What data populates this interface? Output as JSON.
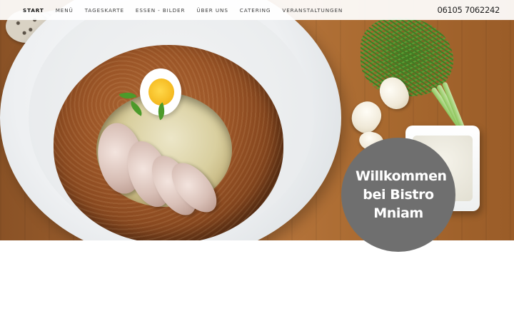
{
  "nav": {
    "items": [
      {
        "label": "START",
        "active": true
      },
      {
        "label": "MENÜ",
        "active": false
      },
      {
        "label": "TAGESKARTE",
        "active": false
      },
      {
        "label": "ESSEN - BILDER",
        "active": false
      },
      {
        "label": "ÜBER UNS",
        "active": false
      },
      {
        "label": "CATERING",
        "active": false
      },
      {
        "label": "VERANSTALTUNGEN",
        "active": false
      }
    ]
  },
  "header": {
    "phone": "06105 7062242"
  },
  "hero": {
    "image_icon": "bread-bowl-soup-photo",
    "welcome_line1": "Willkommen",
    "welcome_line2": "bei Bistro",
    "welcome_line3": "Mniam",
    "badge_color": "#6f6f6f"
  }
}
